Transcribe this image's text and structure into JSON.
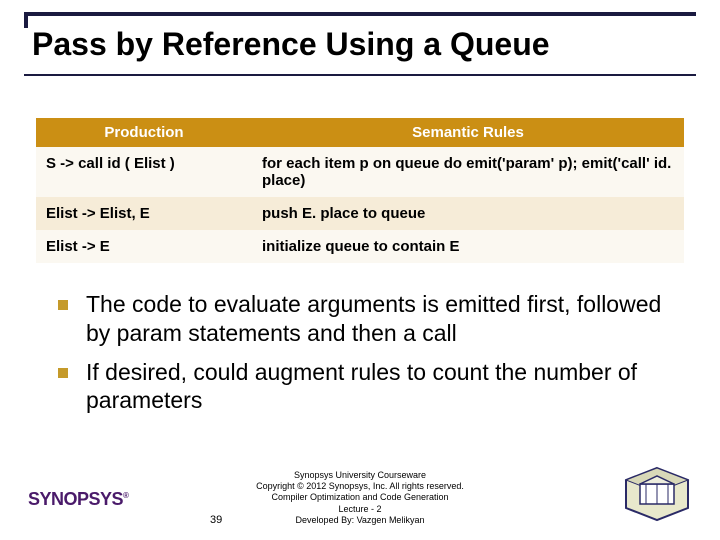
{
  "title": "Pass by Reference Using a Queue",
  "table": {
    "headers": {
      "production": "Production",
      "rules": "Semantic Rules"
    },
    "rows": [
      {
        "production": "S -> call id ( Elist )",
        "rules": "for each item p on queue do emit('param' p); emit('call' id. place)"
      },
      {
        "production": "Elist -> Elist, E",
        "rules": "push E. place to queue"
      },
      {
        "production": "Elist -> E",
        "rules": "initialize queue to contain E"
      }
    ]
  },
  "bullets": [
    "The code to evaluate arguments is emitted first, followed by param statements and then a call",
    "If desired, could augment rules to count the number of parameters"
  ],
  "footer": {
    "line1": "Synopsys University Courseware",
    "line2": "Copyright © 2012 Synopsys, Inc. All rights reserved.",
    "line3": "Compiler Optimization and Code Generation",
    "line4": "Lecture - 2",
    "line5": "Developed By: Vazgen Melikyan"
  },
  "page_number": "39",
  "logo_left": "SYNOPSYS",
  "logo_left_mark": "®"
}
